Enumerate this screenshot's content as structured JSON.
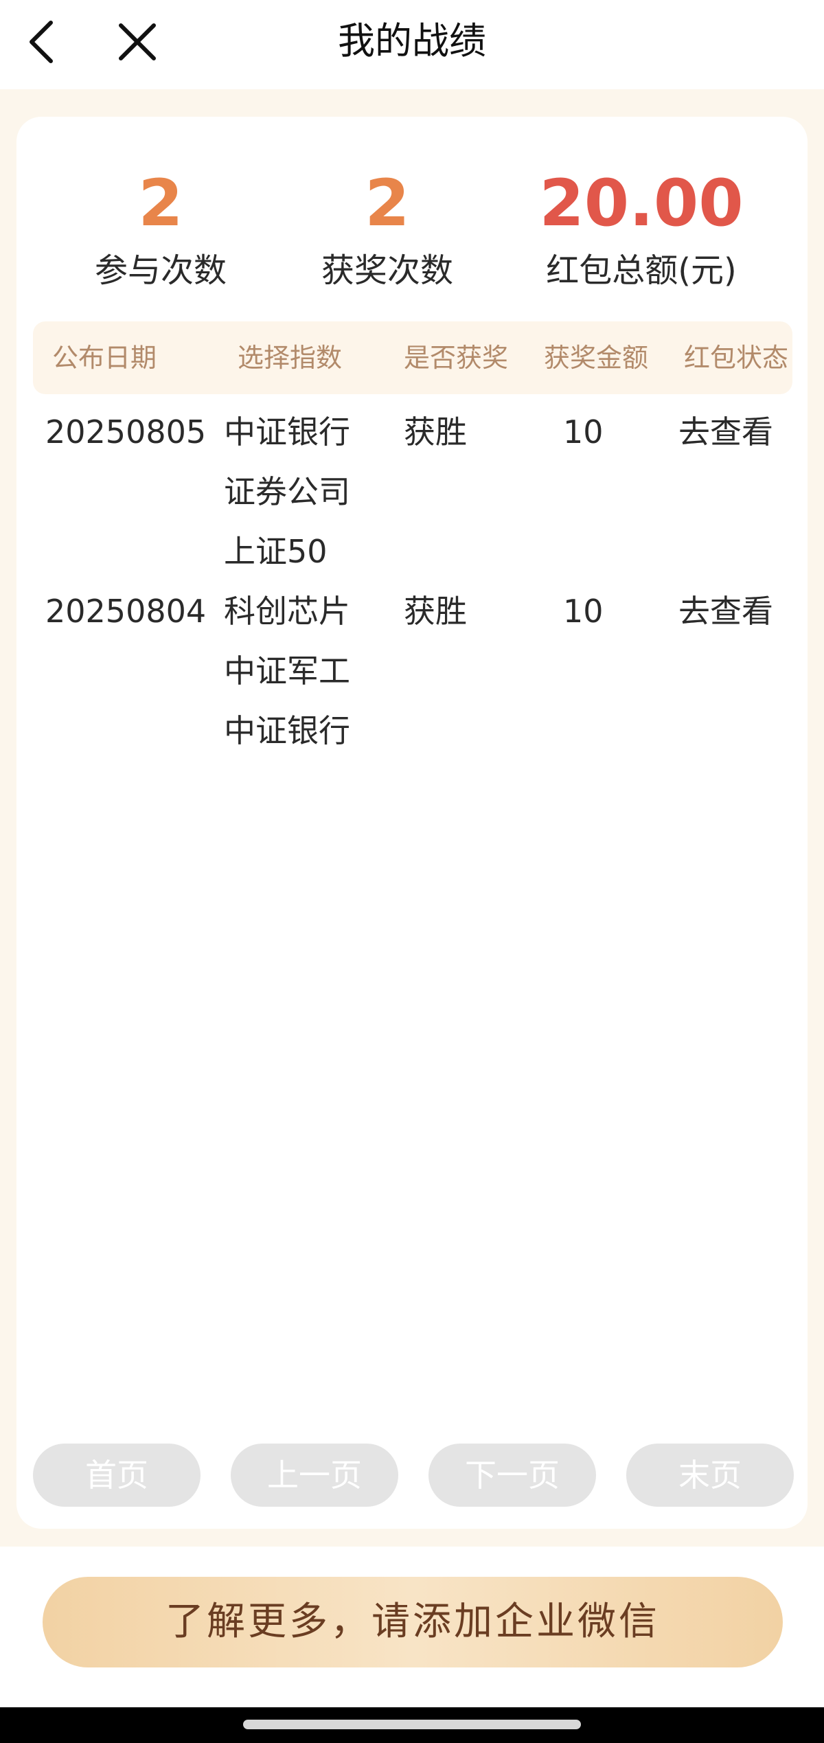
{
  "nav": {
    "title": "我的战绩",
    "back_icon": "chevron-left-icon",
    "close_icon": "close-icon"
  },
  "stats": [
    {
      "value": "2",
      "label": "参与次数"
    },
    {
      "value": "2",
      "label": "获奖次数"
    },
    {
      "value": "20.00",
      "label": "红包总额(元)"
    }
  ],
  "table": {
    "headers": [
      "公布日期",
      "选择指数",
      "是否获奖",
      "获奖金额",
      "红包状态"
    ],
    "rows": [
      {
        "date": "20250805",
        "indices": [
          "中证银行",
          "证券公司",
          "上证50"
        ],
        "result": "获胜",
        "amount": "10",
        "status": "去查看"
      },
      {
        "date": "20250804",
        "indices": [
          "科创芯片",
          "中证军工",
          "中证银行"
        ],
        "result": "获胜",
        "amount": "10",
        "status": "去查看"
      }
    ]
  },
  "pagination": {
    "first": "首页",
    "prev": "上一页",
    "next": "下一页",
    "last": "末页"
  },
  "cta": {
    "label": "了解更多，请添加企业微信"
  },
  "colors": {
    "accent_orange": "#e8854a",
    "accent_red": "#e1574a",
    "page_bg": "#fcf6ec",
    "cta_text": "#6a3d22"
  }
}
